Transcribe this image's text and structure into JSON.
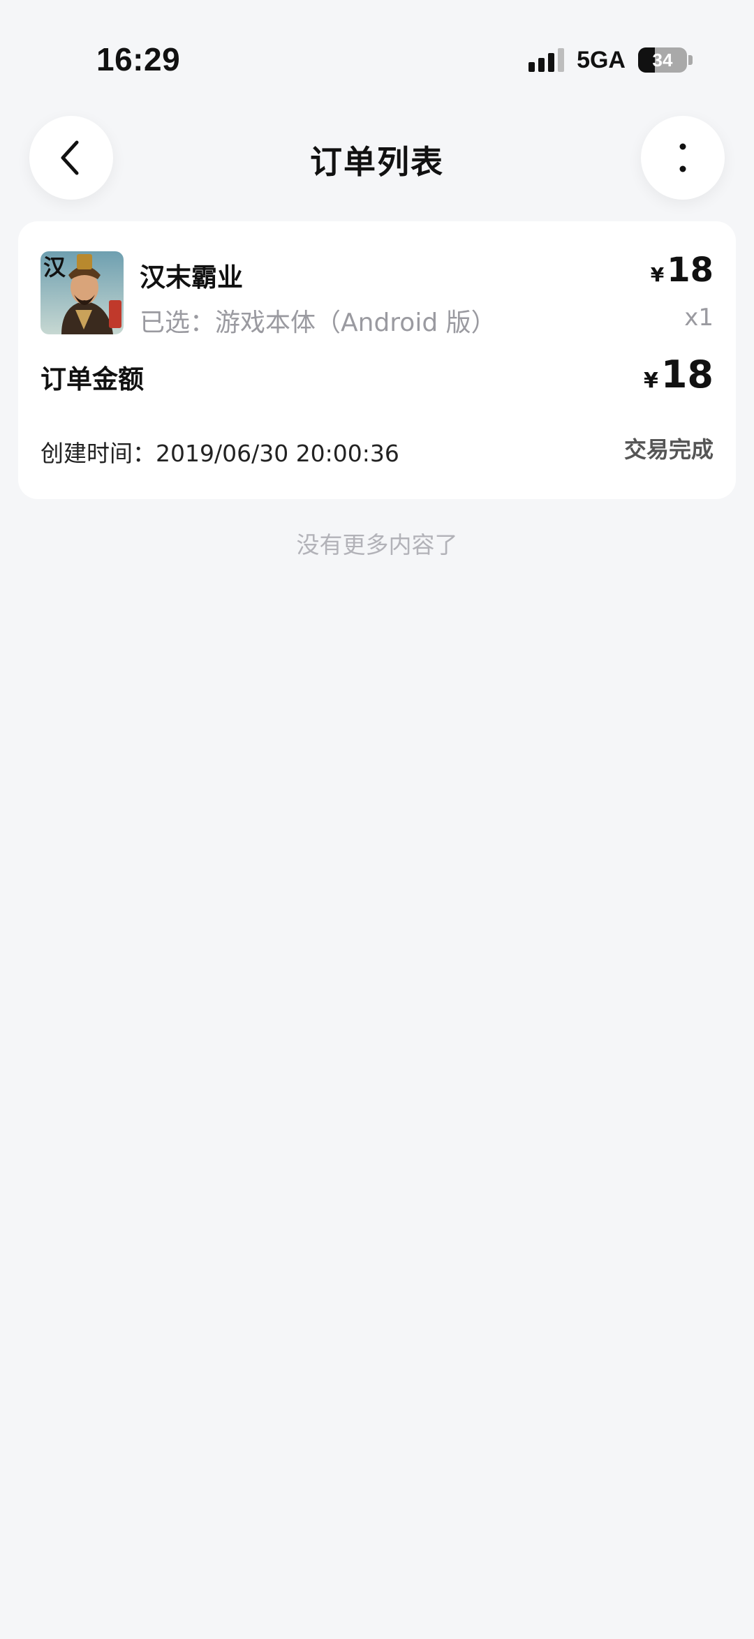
{
  "status_bar": {
    "time": "16:29",
    "network": "5GA",
    "battery": "34"
  },
  "header": {
    "title": "订单列表",
    "back_icon": "chevron-left-icon",
    "more_icon": "more-vertical-icon"
  },
  "order": {
    "game_name": "汉末霸业",
    "currency": "¥",
    "unit_price": "18",
    "selection": "已选：游戏本体（Android 版）",
    "quantity": "x1",
    "amount_label": "订单金额",
    "amount": "18",
    "created_at": "创建时间：2019/06/30  20:00:36",
    "status": "交易完成",
    "icon_text": "汉"
  },
  "footer": {
    "no_more": "没有更多内容了"
  }
}
